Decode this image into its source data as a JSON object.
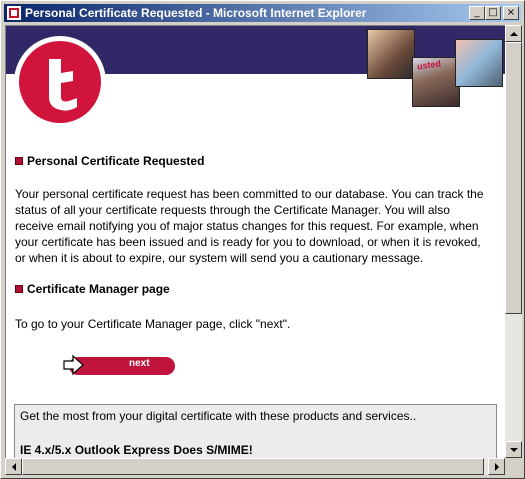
{
  "window": {
    "title": "Personal Certificate Requested - Microsoft Internet Explorer",
    "minimize_glyph": "_",
    "maximize_glyph": "□",
    "close_glyph": "×"
  },
  "header": {
    "logo_icon": "t-logo-icon",
    "photo_label": "usted"
  },
  "section1": {
    "heading": "Personal Certificate Requested",
    "lines": [
      "Your personal certificate request has been committed to our database. You can track the",
      "status of all your certificate requests through the Certificate Manager. You will also",
      "receive email notifying you of major status changes for this request. For example, when",
      "your certificate has been issued and is ready for you to download, or when it is revoked,",
      "or when it is about to expire, our system will send you a cautionary message."
    ]
  },
  "section2": {
    "heading": "Certificate Manager page",
    "text": "To go to your Certificate Manager page, click \"next\"."
  },
  "next_button": {
    "label": "next"
  },
  "promo": {
    "intro": "Get the most from your digital certificate with these products and services..",
    "product": "IE 4.x/5.x Outlook Express Does S/MIME!"
  },
  "colors": {
    "brand_red": "#d0143c",
    "header_purple": "#312868",
    "title_gradient_start": "#0a246a"
  }
}
